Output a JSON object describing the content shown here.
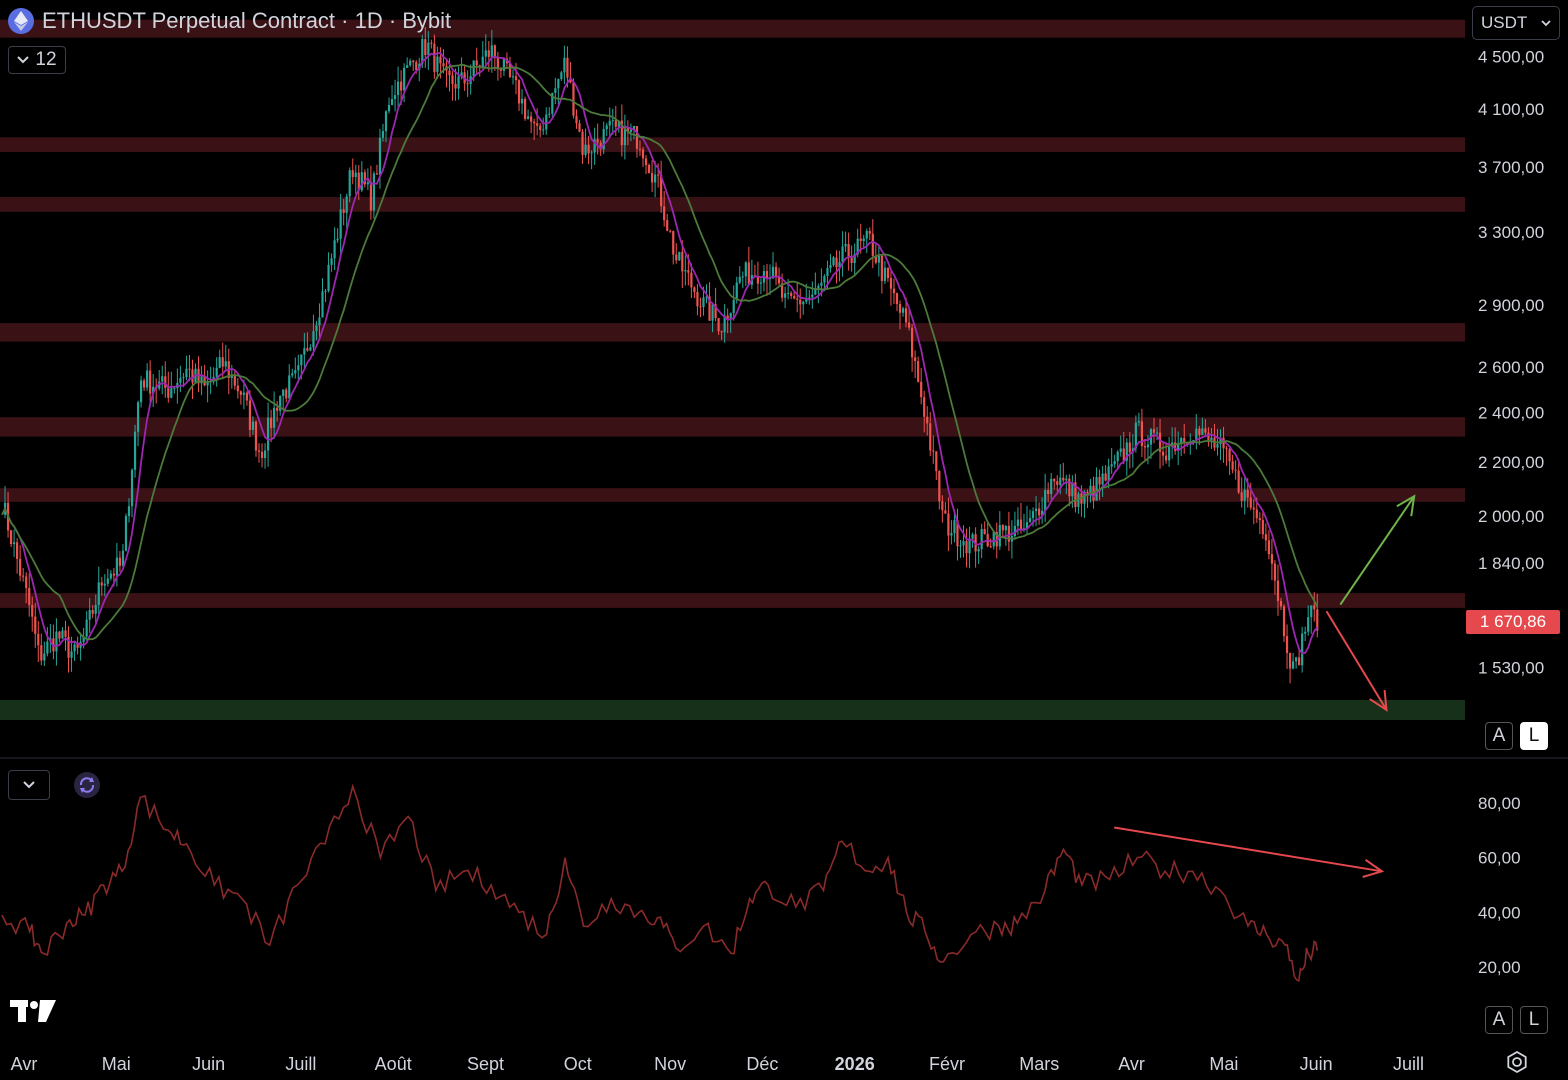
{
  "header": {
    "title": "ETHUSDT Perpetual Contract · 1D · Bybit",
    "indicators_count": "12",
    "currency": "USDT",
    "current_price_label": "1 670,86",
    "toggle_a": "A",
    "toggle_l": "L"
  },
  "colors": {
    "background": "#000000",
    "resistance_zone": "#3a1216",
    "support_zone": "#17301a",
    "candle_up": "#26a69a",
    "candle_down": "#ef5350",
    "ma_fast": "#9c27b0",
    "ma_slow": "#4c7a3a",
    "rsi_line": "#8b2a2a",
    "arrow_up": "#6fb34a",
    "arrow_down": "#e5484d",
    "price_tag": "#e5484d"
  },
  "chart_data": [
    {
      "type": "candlestick",
      "title": "ETHUSDT Perpetual Contract · 1D · Bybit",
      "y_scale": "log",
      "ylim": [
        1390,
        4900
      ],
      "y_ticks": [
        {
          "value": 4500,
          "label": "4 500,00"
        },
        {
          "value": 4100,
          "label": "4 100,00"
        },
        {
          "value": 3700,
          "label": "3 700,00"
        },
        {
          "value": 3300,
          "label": "3 300,00"
        },
        {
          "value": 2900,
          "label": "2 900,00"
        },
        {
          "value": 2600,
          "label": "2 600,00"
        },
        {
          "value": 2400,
          "label": "2 400,00"
        },
        {
          "value": 2200,
          "label": "2 200,00"
        },
        {
          "value": 2000,
          "label": "2 000,00"
        },
        {
          "value": 1840,
          "label": "1 840,00"
        },
        {
          "value": 1530,
          "label": "1 530,00"
        }
      ],
      "x_labels": [
        "Avr",
        "Mai",
        "Juin",
        "Juill",
        "Août",
        "Sept",
        "Oct",
        "Nov",
        "Déc",
        "2026",
        "Févr",
        "Mars",
        "Avr",
        "Mai",
        "Juin",
        "Juill"
      ],
      "x_label_months_index": [
        0,
        1,
        2,
        3,
        4,
        5,
        6,
        7,
        8,
        9,
        10,
        11,
        12,
        13,
        14,
        15
      ],
      "close_path": [
        [
          0,
          2050
        ],
        [
          0.3,
          1700
        ],
        [
          0.4,
          1560
        ],
        [
          0.6,
          1620
        ],
        [
          0.8,
          1560
        ],
        [
          0.9,
          1620
        ],
        [
          1.1,
          1800
        ],
        [
          1.3,
          1830
        ],
        [
          1.5,
          2550
        ],
        [
          1.8,
          2500
        ],
        [
          2.0,
          2590
        ],
        [
          2.2,
          2500
        ],
        [
          2.4,
          2620
        ],
        [
          2.6,
          2480
        ],
        [
          2.8,
          2230
        ],
        [
          3.0,
          2470
        ],
        [
          3.2,
          2550
        ],
        [
          3.5,
          3000
        ],
        [
          3.8,
          3700
        ],
        [
          4.0,
          3500
        ],
        [
          4.2,
          4200
        ],
        [
          4.4,
          4400
        ],
        [
          4.6,
          4600
        ],
        [
          4.8,
          4300
        ],
        [
          5.0,
          4300
        ],
        [
          5.3,
          4550
        ],
        [
          5.6,
          4200
        ],
        [
          5.8,
          3900
        ],
        [
          6.1,
          4450
        ],
        [
          6.3,
          3800
        ],
        [
          6.6,
          3950
        ],
        [
          6.9,
          3900
        ],
        [
          7.1,
          3600
        ],
        [
          7.3,
          3150
        ],
        [
          7.6,
          2900
        ],
        [
          7.8,
          2800
        ],
        [
          8.0,
          3050
        ],
        [
          8.3,
          3100
        ],
        [
          8.5,
          2900
        ],
        [
          8.8,
          2950
        ],
        [
          9.1,
          3150
        ],
        [
          9.4,
          3250
        ],
        [
          9.6,
          3000
        ],
        [
          9.8,
          2800
        ],
        [
          10.0,
          2400
        ],
        [
          10.2,
          1980
        ],
        [
          10.5,
          1900
        ],
        [
          10.8,
          1940
        ],
        [
          11.1,
          1950
        ],
        [
          11.4,
          2150
        ],
        [
          11.7,
          2050
        ],
        [
          12.0,
          2150
        ],
        [
          12.3,
          2320
        ],
        [
          12.6,
          2250
        ],
        [
          12.9,
          2330
        ],
        [
          13.2,
          2250
        ],
        [
          13.5,
          2050
        ],
        [
          13.7,
          1950
        ],
        [
          13.9,
          1630
        ],
        [
          14.0,
          1510
        ],
        [
          14.15,
          1680
        ],
        [
          14.25,
          1670
        ]
      ],
      "zones": [
        {
          "kind": "resistance",
          "low": 4650,
          "high": 4800
        },
        {
          "kind": "resistance",
          "low": 3800,
          "high": 3900
        },
        {
          "kind": "resistance",
          "low": 3420,
          "high": 3510
        },
        {
          "kind": "resistance",
          "low": 2720,
          "high": 2810
        },
        {
          "kind": "resistance",
          "low": 2300,
          "high": 2380
        },
        {
          "kind": "resistance",
          "low": 2050,
          "high": 2100
        },
        {
          "kind": "resistance",
          "low": 1700,
          "high": 1745
        },
        {
          "kind": "support",
          "low": 1395,
          "high": 1445
        }
      ],
      "current_price": 1670.86,
      "projections": [
        {
          "direction": "up",
          "from": [
            14.5,
            1710
          ],
          "to": [
            15.3,
            2070
          ]
        },
        {
          "direction": "down",
          "from": [
            14.35,
            1690
          ],
          "to": [
            15.0,
            1420
          ]
        }
      ],
      "legend": "none",
      "grid": false
    },
    {
      "type": "line",
      "title": "",
      "ylim": [
        8,
        92
      ],
      "y_ticks": [
        {
          "value": 80,
          "label": "80,00"
        },
        {
          "value": 60,
          "label": "60,00"
        },
        {
          "value": 40,
          "label": "40,00"
        },
        {
          "value": 20,
          "label": "20,00"
        }
      ],
      "rsi": [
        [
          0,
          39
        ],
        [
          0.3,
          33
        ],
        [
          0.45,
          25
        ],
        [
          0.7,
          36
        ],
        [
          0.9,
          39
        ],
        [
          1.1,
          50
        ],
        [
          1.3,
          55
        ],
        [
          1.5,
          82
        ],
        [
          1.8,
          70
        ],
        [
          2.0,
          65
        ],
        [
          2.3,
          50
        ],
        [
          2.6,
          45
        ],
        [
          2.9,
          28
        ],
        [
          3.2,
          50
        ],
        [
          3.5,
          65
        ],
        [
          3.8,
          86
        ],
        [
          4.1,
          60
        ],
        [
          4.4,
          75
        ],
        [
          4.7,
          48
        ],
        [
          5.0,
          55
        ],
        [
          5.3,
          50
        ],
        [
          5.6,
          40
        ],
        [
          5.9,
          32
        ],
        [
          6.1,
          60
        ],
        [
          6.3,
          35
        ],
        [
          6.6,
          45
        ],
        [
          6.9,
          40
        ],
        [
          7.1,
          38
        ],
        [
          7.3,
          27
        ],
        [
          7.6,
          35
        ],
        [
          7.9,
          25
        ],
        [
          8.1,
          45
        ],
        [
          8.3,
          50
        ],
        [
          8.6,
          42
        ],
        [
          8.9,
          48
        ],
        [
          9.1,
          66
        ],
        [
          9.4,
          55
        ],
        [
          9.6,
          60
        ],
        [
          9.8,
          40
        ],
        [
          10.0,
          33
        ],
        [
          10.2,
          22
        ],
        [
          10.5,
          32
        ],
        [
          10.8,
          35
        ],
        [
          11.0,
          36
        ],
        [
          11.3,
          48
        ],
        [
          11.5,
          63
        ],
        [
          11.7,
          50
        ],
        [
          12.0,
          52
        ],
        [
          12.3,
          60
        ],
        [
          12.6,
          55
        ],
        [
          12.9,
          55
        ],
        [
          13.2,
          48
        ],
        [
          13.5,
          35
        ],
        [
          13.7,
          32
        ],
        [
          13.9,
          28
        ],
        [
          14.05,
          15
        ],
        [
          14.15,
          25
        ],
        [
          14.25,
          26
        ]
      ],
      "divergence_arrow": {
        "from": [
          12.05,
          71
        ],
        "to": [
          14.95,
          55
        ]
      },
      "legend": "none",
      "grid": false
    }
  ]
}
